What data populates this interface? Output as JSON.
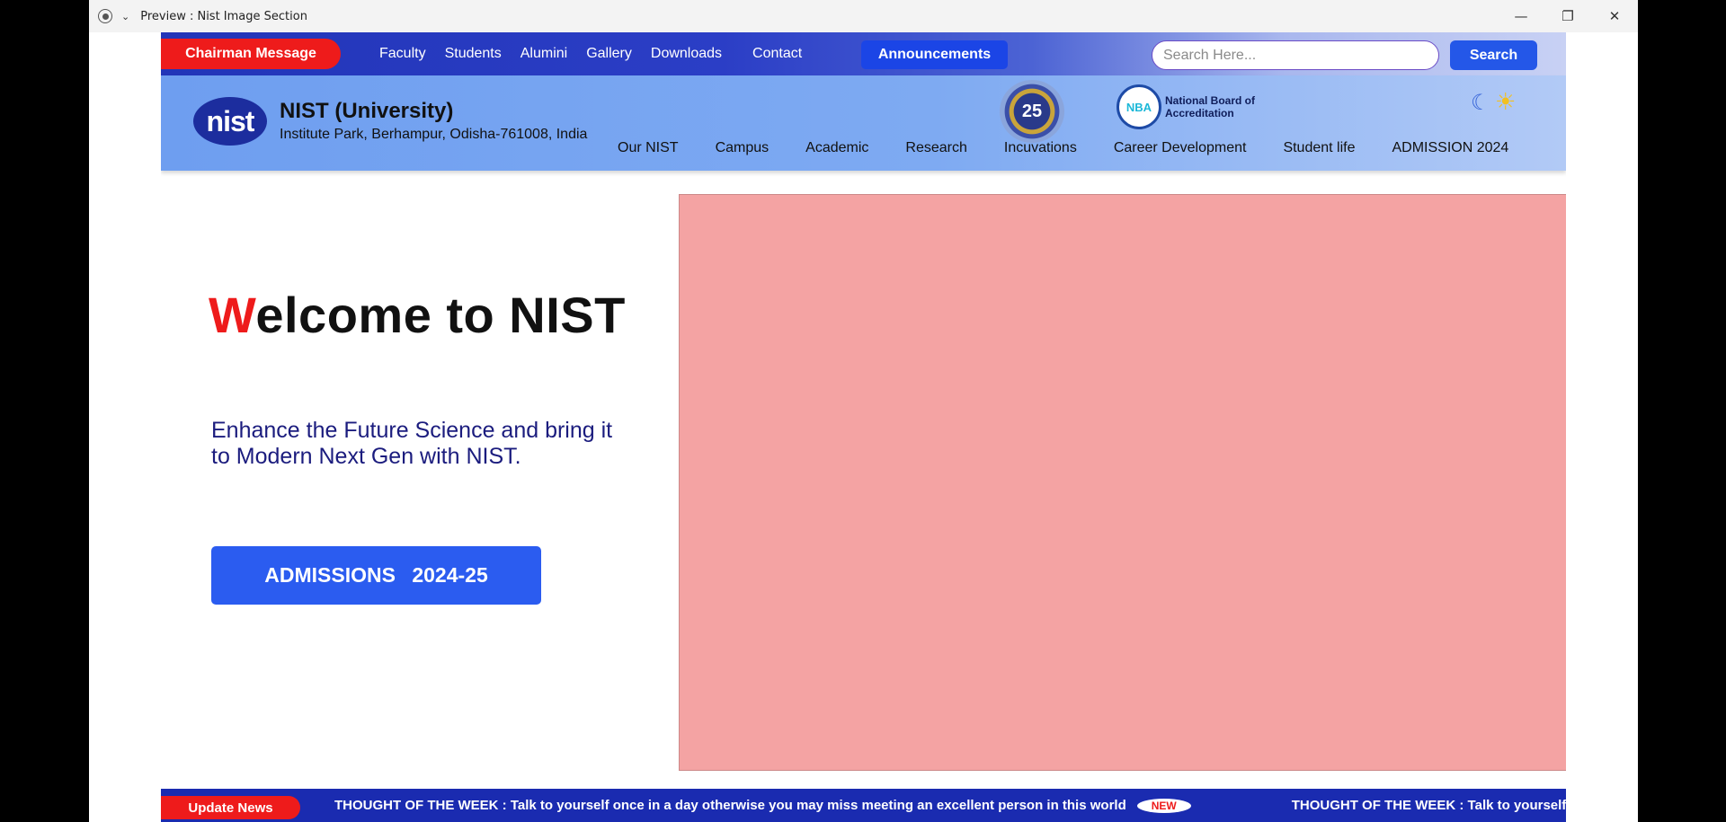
{
  "window": {
    "title": "Preview : Nist Image Section",
    "controls": {
      "minimize": "—",
      "restore": "❐",
      "close": "✕"
    }
  },
  "topbar": {
    "chairman_label": "Chairman Message",
    "nav": [
      "Faculty",
      "Students",
      "Alumini",
      "Gallery",
      "Downloads",
      "Contact"
    ],
    "announcements_label": "Announcements",
    "search_placeholder": "Search Here...",
    "search_button": "Search"
  },
  "header": {
    "logo_text": "nist",
    "university_name": "NIST (University)",
    "address": "Institute Park, Berhampur, Odisha-761008, India",
    "badge_number": "25",
    "nba_logo_text": "NBA",
    "nba_text": "National Board of Accreditation",
    "nav": [
      "Our NIST",
      "Campus",
      "Academic",
      "Research",
      "Incuvations",
      "Career Development",
      "Student life",
      "ADMISSION 2024"
    ]
  },
  "hero": {
    "welcome_first_letter": "W",
    "welcome_rest": "elcome to NIST",
    "tagline": "Enhance the Future Science and bring it to Modern Next Gen with NIST.",
    "admissions_button": "ADMISSIONS 2024-25"
  },
  "news": {
    "label": "Update News",
    "message": "THOUGHT OF THE WEEK : Talk to yourself once in a day otherwise you may miss meeting an excellent person in this world",
    "new_badge": "NEW",
    "message_repeat": "THOUGHT OF THE WEEK : Talk to yourself once in a day otherwise you may miss meeting an excellent person in this world"
  },
  "colors": {
    "accent_red": "#ee1b1b",
    "primary_blue": "#2b5cf0",
    "image_placeholder": "#f4a3a3"
  },
  "icons": [
    "record-icon",
    "chevron-down-icon",
    "moon-icon",
    "sun-icon"
  ]
}
